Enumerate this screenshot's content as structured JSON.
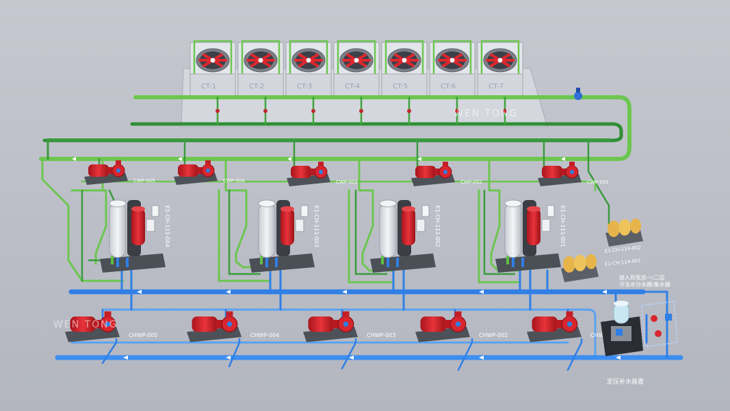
{
  "cooling_towers": [
    "CT-1",
    "CT-2",
    "CT-3",
    "CT-4",
    "CT-5",
    "CT-6",
    "CT-7"
  ],
  "cooling_water_pumps": [
    "CWP-005",
    "CWP-004",
    "CWP-003",
    "CWP-002",
    "CWP-001"
  ],
  "chillers": [
    "E1-CH-111-004",
    "E1-CH-111-003",
    "E1-CH-111-002",
    "E1-CH-111-001"
  ],
  "chilled_water_pumps": [
    "CHWP-005",
    "CHWP-004",
    "CHWP-003",
    "CHWP-002",
    "CHWP-001"
  ],
  "dosing_units": [
    "E1-CH-114-002",
    "E1-CH-114-001"
  ],
  "annotation": [
    "接入到泵房一/二层",
    "冷冻水分水器/集水器"
  ],
  "pressurization_label": "定压补水装置",
  "watermark_top": "WEN TONG",
  "watermark_left": "WEN TONG",
  "colors": {
    "background": "#b9bcc5",
    "condenser_pipe": "#5fbf45",
    "condenser_pipe_dark": "#2f8f35",
    "chilled_pipe": "#2f7fe6",
    "chilled_pipe_light": "#5aa2f0",
    "pump_red": "#d8262e",
    "tower_body": "#dde1e6"
  }
}
